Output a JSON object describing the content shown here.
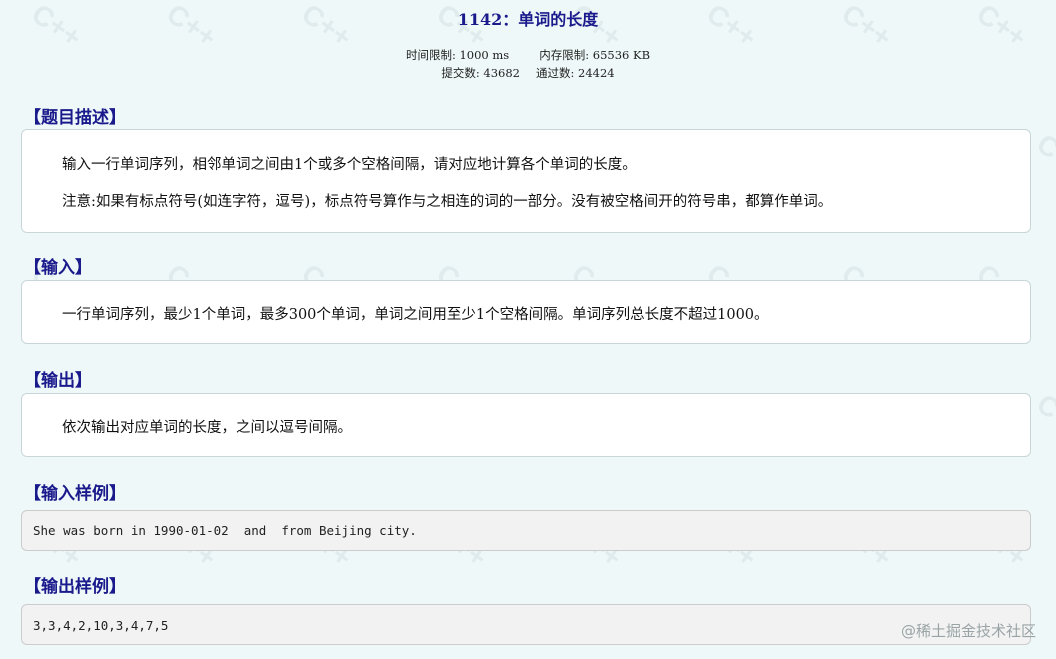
{
  "problem": {
    "title": "1142：单词的长度",
    "time_limit_label": "时间限制: 1000 ms",
    "memory_limit_label": "内存限制: 65536 KB",
    "submissions_label": "提交数: 43682",
    "accepted_label": "通过数: 24424"
  },
  "sections": {
    "description": {
      "heading": "【题目描述】",
      "lines": [
        "输入一行单词序列，相邻单词之间由1个或多个空格间隔，请对应地计算各个单词的长度。",
        "注意:如果有标点符号(如连字符，逗号)，标点符号算作与之相连的词的一部分。没有被空格间开的符号串，都算作单词。"
      ]
    },
    "input": {
      "heading": "【输入】",
      "text": "一行单词序列，最少1个单词，最多300个单词，单词之间用至少1个空格间隔。单词序列总长度不超过1000。"
    },
    "output": {
      "heading": "【输出】",
      "text": "依次输出对应单词的长度，之间以逗号间隔。"
    },
    "sample_input": {
      "heading": "【输入样例】",
      "code": "She was born in 1990-01-02  and  from Beijing city."
    },
    "sample_output": {
      "heading": "【输出样例】",
      "code": "3,3,4,2,10,3,4,7,5"
    }
  },
  "watermark": {
    "credit": "@稀土掘金技术社区",
    "tile_text": "C++"
  }
}
